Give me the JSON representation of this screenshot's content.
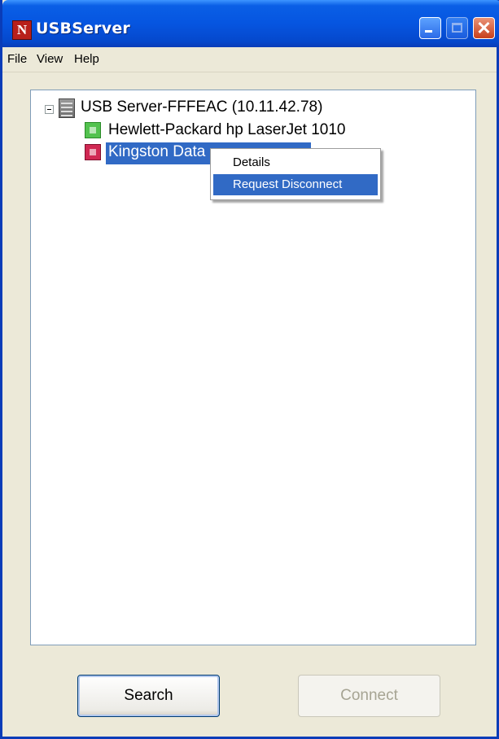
{
  "window": {
    "title": "USBServer",
    "app_icon_letter": "N"
  },
  "menu": [
    "File",
    "View",
    "Help"
  ],
  "tree": {
    "server": "USB Server-FFFEAC (10.11.42.78)",
    "devices": [
      {
        "label": "Hewlett-Packard hp LaserJet 1010",
        "status_color": "#53C24F"
      },
      {
        "label": "Kingston Data",
        "status_color": "#D02853",
        "selected": true
      }
    ]
  },
  "context_menu": {
    "items": [
      "Details",
      "Request Disconnect"
    ],
    "highlighted": "Request Disconnect"
  },
  "buttons": {
    "search": "Search",
    "connect": "Connect"
  }
}
